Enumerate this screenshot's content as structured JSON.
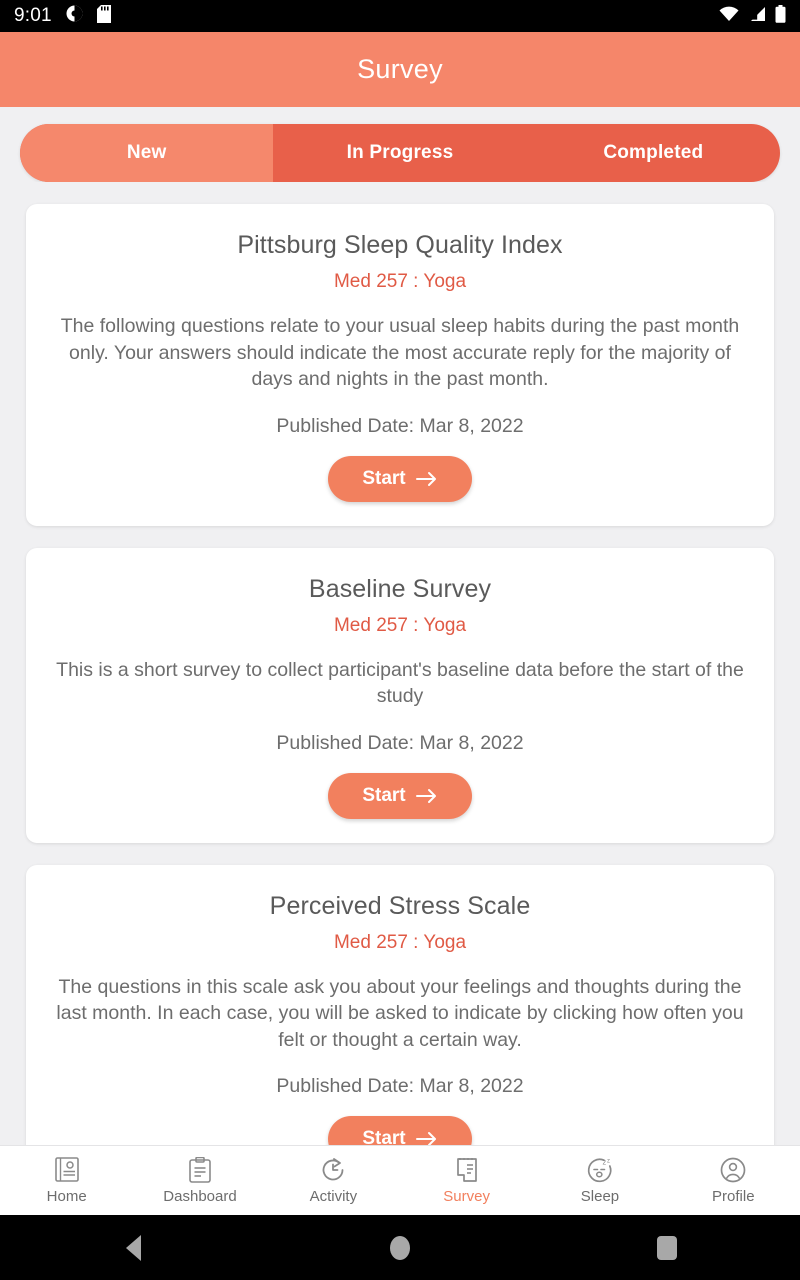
{
  "status_bar": {
    "time": "9:01",
    "left_icons": [
      "contrast-circle-icon",
      "sd-card-icon"
    ],
    "right_icons": [
      "wifi-icon",
      "cellular-signal-icon",
      "battery-icon"
    ]
  },
  "header": {
    "title": "Survey"
  },
  "tabs": [
    {
      "label": "New",
      "active": true
    },
    {
      "label": "In Progress",
      "active": false
    },
    {
      "label": "Completed",
      "active": false
    }
  ],
  "surveys": [
    {
      "title": "Pittsburg Sleep Quality Index",
      "study": "Med 257 : Yoga",
      "description": "The following questions relate to your usual sleep habits during the past month only. Your answers should indicate the most accurate reply for the majority of days and nights in the past month.",
      "published": "Published Date: Mar 8, 2022",
      "action": "Start"
    },
    {
      "title": "Baseline Survey",
      "study": "Med 257 : Yoga",
      "description": "This is a short survey to collect participant's baseline data before the start of the study",
      "published": "Published Date: Mar 8, 2022",
      "action": "Start"
    },
    {
      "title": "Perceived Stress Scale",
      "study": "Med 257 : Yoga",
      "description": "The questions in this scale ask you about your feelings and thoughts during the last month. In each case, you will be asked to indicate by clicking how often you felt or thought a certain way.",
      "published": "Published Date: Mar 8, 2022",
      "action": "Start"
    }
  ],
  "bottom_nav": [
    {
      "label": "Home",
      "icon": "book-gear-icon",
      "active": false
    },
    {
      "label": "Dashboard",
      "icon": "clipboard-icon",
      "active": false
    },
    {
      "label": "Activity",
      "icon": "clock-refresh-icon",
      "active": false
    },
    {
      "label": "Survey",
      "icon": "receipt-document-icon",
      "active": true
    },
    {
      "label": "Sleep",
      "icon": "sleeping-face-icon",
      "active": false
    },
    {
      "label": "Profile",
      "icon": "account-circle-icon",
      "active": false
    }
  ],
  "system_nav": [
    {
      "name": "back",
      "icon": "triangle-back-icon"
    },
    {
      "name": "home",
      "icon": "circle-home-icon"
    },
    {
      "name": "recents",
      "icon": "square-recents-icon"
    }
  ],
  "colors": {
    "accent": "#f2805e",
    "header": "#f5866a",
    "tab_track": "#e8604a",
    "tab_active": "#f5886c",
    "study_text": "#e05a45",
    "page_bg": "#f0f0f2",
    "card_bg": "#ffffff",
    "body_text": "#6d6d6d"
  }
}
